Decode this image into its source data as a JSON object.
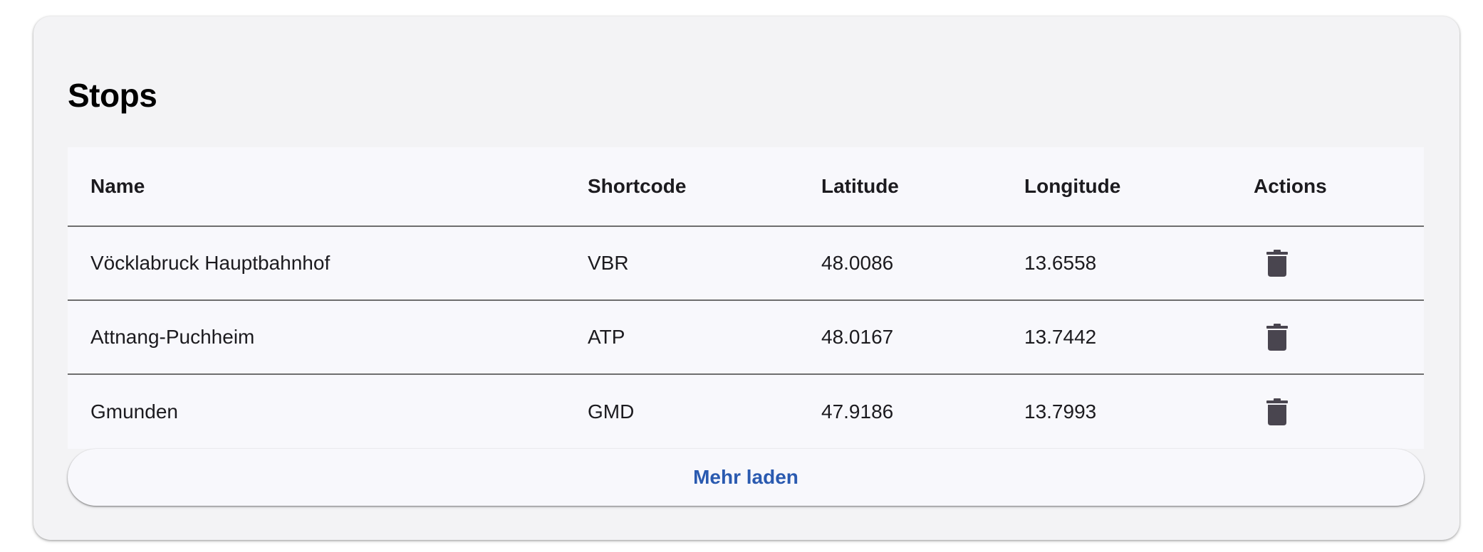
{
  "card": {
    "title": "Stops"
  },
  "table": {
    "headers": {
      "name": "Name",
      "shortcode": "Shortcode",
      "latitude": "Latitude",
      "longitude": "Longitude",
      "actions": "Actions"
    },
    "rows": [
      {
        "name": "Vöcklabruck Hauptbahnhof",
        "shortcode": "VBR",
        "latitude": "48.0086",
        "longitude": "13.6558",
        "action_icon": "trash-icon"
      },
      {
        "name": "Attnang-Puchheim",
        "shortcode": "ATP",
        "latitude": "48.0167",
        "longitude": "13.7442",
        "action_icon": "trash-icon"
      },
      {
        "name": "Gmunden",
        "shortcode": "GMD",
        "latitude": "47.9186",
        "longitude": "13.7993",
        "action_icon": "trash-icon"
      }
    ]
  },
  "load_more": {
    "label": "Mehr laden"
  },
  "colors": {
    "card_background": "#f3f3f5",
    "table_background": "#f8f8fc",
    "divider": "#6e6e6e",
    "accent": "#2a5ab0",
    "icon": "#49454f"
  }
}
